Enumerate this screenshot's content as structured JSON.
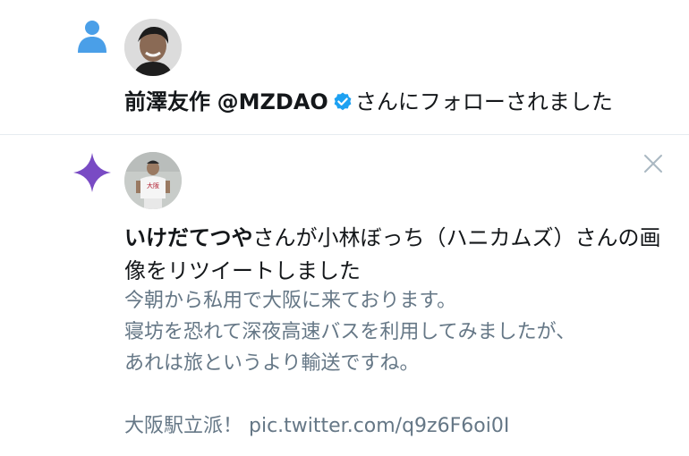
{
  "notifications": [
    {
      "type_icon": "person-icon",
      "user_name": "前澤友作",
      "user_handle": "@MZDAO",
      "action_text": "さんにフォローされました"
    },
    {
      "type_icon": "sparkle-icon",
      "user_name": "いけだてつや",
      "action_text": "さんが小林ぼっち（ハニカムズ）さんの画像をリツイートしました",
      "tweet_lines": [
        "今朝から私用で大阪に来ております。",
        "寝坊を恐れて深夜高速バスを利用してみましたが、",
        "あれは旅というより輸送ですね。"
      ],
      "tweet_footer": "大阪駅立派！ pic.twitter.com/q9z6F6oi0I",
      "close_icon": "close-icon"
    }
  ],
  "colors": {
    "person_icon": "#4a9fe8",
    "sparkle_icon": "#794bc4",
    "verified": "#1da1f2",
    "secondary_text": "#657786",
    "divider": "#e6ecf0",
    "close": "#aab8c2"
  }
}
